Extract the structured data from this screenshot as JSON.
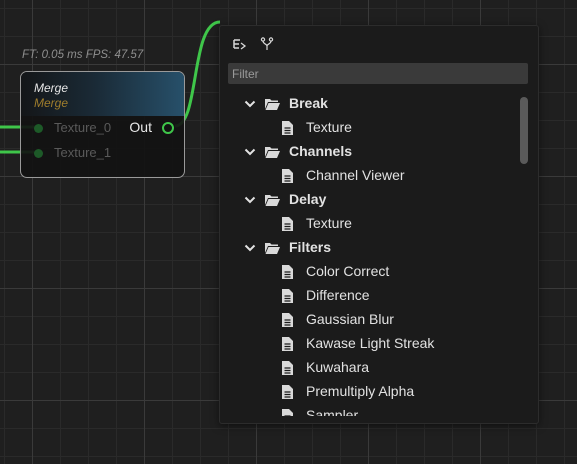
{
  "stats": {
    "text": "FT: 0.05 ms FPS: 47.57"
  },
  "node": {
    "title": "Merge",
    "subtitle": "Merge",
    "inputs": [
      "Texture_0",
      "Texture_1"
    ],
    "output": "Out"
  },
  "popup": {
    "filter_placeholder": "Filter",
    "filter_value": "",
    "toolbar_icons": [
      "collapse-tree-icon",
      "fork-icon"
    ],
    "tree": [
      {
        "type": "category",
        "label": "Break"
      },
      {
        "type": "item",
        "label": "Texture"
      },
      {
        "type": "category",
        "label": "Channels"
      },
      {
        "type": "item",
        "label": "Channel Viewer"
      },
      {
        "type": "category",
        "label": "Delay"
      },
      {
        "type": "item",
        "label": "Texture"
      },
      {
        "type": "category",
        "label": "Filters"
      },
      {
        "type": "item",
        "label": "Color Correct"
      },
      {
        "type": "item",
        "label": "Difference"
      },
      {
        "type": "item",
        "label": "Gaussian Blur"
      },
      {
        "type": "item",
        "label": "Kawase Light Streak"
      },
      {
        "type": "item",
        "label": "Kuwahara"
      },
      {
        "type": "item",
        "label": "Premultiply Alpha"
      },
      {
        "type": "item",
        "label": "Sampler"
      }
    ]
  },
  "colors": {
    "wire": "#3fc64a",
    "pin_in": "#1d5a28",
    "node_subtitle": "#a07e2c",
    "popup_bg": "#1b1b1b"
  }
}
